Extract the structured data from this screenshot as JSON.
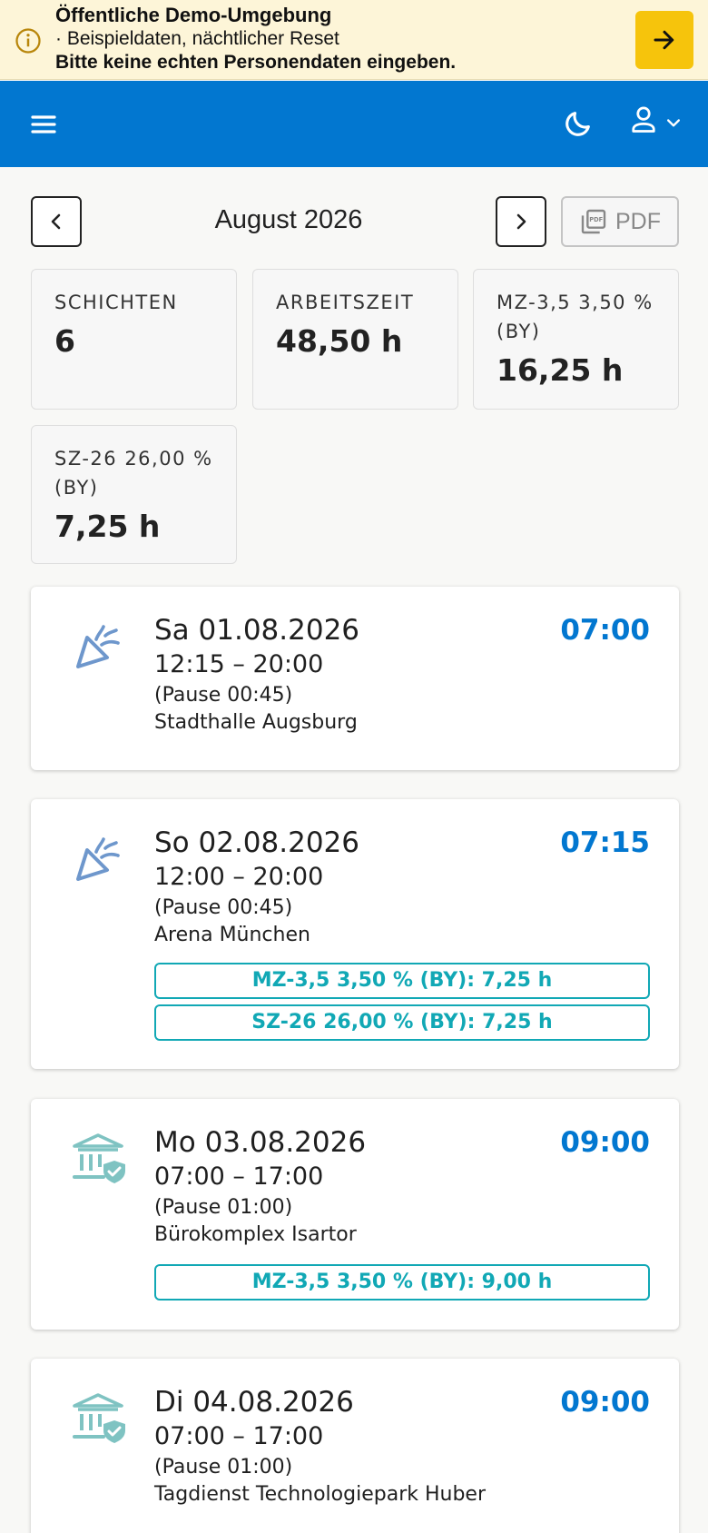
{
  "banner": {
    "title": "Öffentliche Demo-Umgebung",
    "subtitle": "· Beispieldaten, nächtlicher Reset",
    "warning": "Bitte keine echten Personendaten eingeben.",
    "icon": "info-icon",
    "action_icon": "arrow-right-icon",
    "background": "#fdf5d8",
    "accent": "#f6c40c"
  },
  "appbar": {
    "color": "#0277d0",
    "menu_icon": "hamburger-menu-icon",
    "theme_icon": "moon-icon",
    "account_icon": "user-icon"
  },
  "month_nav": {
    "title": "August 2026",
    "prev_icon": "chevron-left-icon",
    "next_icon": "chevron-right-icon",
    "pdf_label": "PDF"
  },
  "stats": [
    {
      "label": "SCHICHTEN",
      "value": "6"
    },
    {
      "label": "ARBEITSZEIT",
      "value": "48,50 h"
    },
    {
      "label_line1": "MZ-3,5 3,50 %",
      "label_line2": "(BY)",
      "value": "16,25 h"
    },
    {
      "label_line1": "SZ-26 26,00 %",
      "label_line2": "(BY)",
      "value": "7,25 h"
    }
  ],
  "shifts": [
    {
      "icon": "party-popper-icon",
      "date": "Sa 01.08.2026",
      "time": "12:15 – 20:00",
      "pause": "(Pause 00:45)",
      "location": "Stadthalle Augsburg",
      "total": "07:00",
      "chips": []
    },
    {
      "icon": "party-popper-icon",
      "date": "So 02.08.2026",
      "time": "12:00 – 20:00",
      "pause": "(Pause 00:45)",
      "location": "Arena München",
      "total": "07:15",
      "chips": [
        "MZ-3,5 3,50 % (BY): 7,25 h",
        "SZ-26 26,00 % (BY): 7,25 h"
      ]
    },
    {
      "icon": "bank-shield-icon",
      "date": "Mo 03.08.2026",
      "time": "07:00 – 17:00",
      "pause": "(Pause 01:00)",
      "location": "Bürokomplex Isartor",
      "total": "09:00",
      "chips": [
        "MZ-3,5 3,50 % (BY): 9,00 h"
      ]
    },
    {
      "icon": "bank-shield-icon",
      "date": "Di 04.08.2026",
      "time": "07:00 – 17:00",
      "pause": "(Pause 01:00)",
      "location": "Tagdienst Technologiepark Huber",
      "total": "09:00",
      "chips": []
    }
  ],
  "colors": {
    "primary": "#0277d0",
    "chip": "#11a8b5",
    "holiday_icon": "#6e97cc",
    "institution_icon": "#7fc3c2"
  }
}
